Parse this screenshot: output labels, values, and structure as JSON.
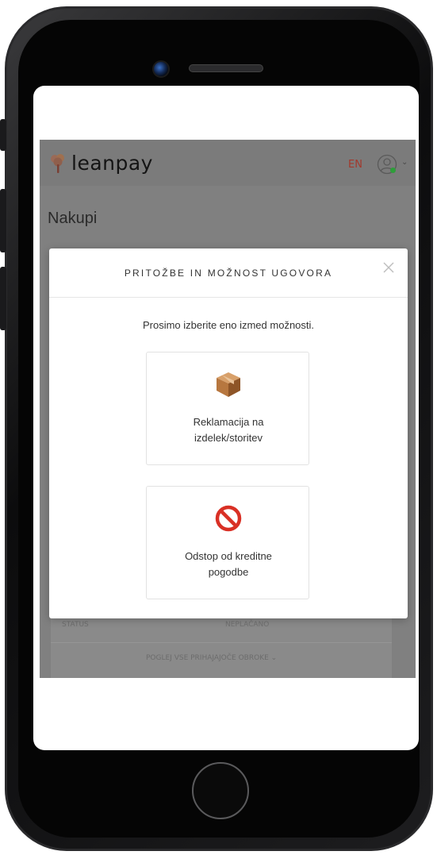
{
  "app": {
    "logo_text": "leanpay",
    "language": "EN",
    "page_title": "Nakupi"
  },
  "background_card": {
    "status_label": "STATUS",
    "status_value": "NEPLAČANO",
    "more_link": "POGLEJ VSE PRIHAJAJOČE OBROKE"
  },
  "modal": {
    "title": "PRITOŽBE IN MOŽNOST UGOVORA",
    "subtitle": "Prosimo izberite eno izmed možnosti.",
    "options": [
      {
        "label_line1": "Reklamacija na",
        "label_line2": "izdelek/storitev",
        "icon": "package-icon"
      },
      {
        "label_line1": "Odstop od kreditne",
        "label_line2": "pogodbe",
        "icon": "prohibited-icon"
      }
    ]
  },
  "colors": {
    "overlay": "#808080",
    "language_accent": "#a3382c",
    "prohibited_red": "#d93025",
    "package_brown": "#b7773f",
    "user_status_green": "#2e9e3a"
  }
}
